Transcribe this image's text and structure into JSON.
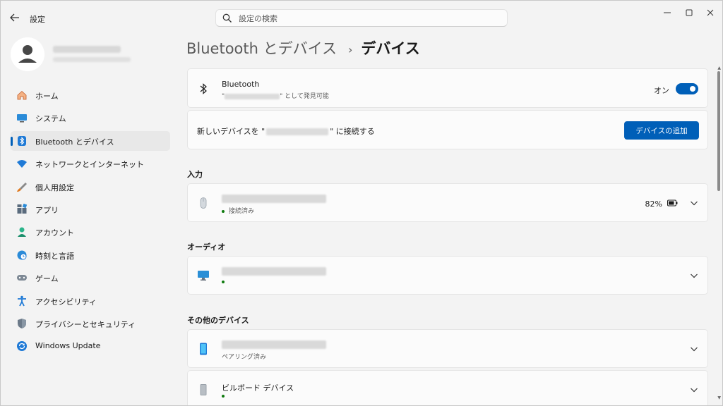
{
  "app": {
    "title": "設定"
  },
  "search": {
    "placeholder": "設定の検索"
  },
  "sidebar": {
    "items": [
      {
        "label": "ホーム"
      },
      {
        "label": "システム"
      },
      {
        "label": "Bluetooth とデバイス"
      },
      {
        "label": "ネットワークとインターネット"
      },
      {
        "label": "個人用設定"
      },
      {
        "label": "アプリ"
      },
      {
        "label": "アカウント"
      },
      {
        "label": "時刻と言語"
      },
      {
        "label": "ゲーム"
      },
      {
        "label": "アクセシビリティ"
      },
      {
        "label": "プライバシーとセキュリティ"
      },
      {
        "label": "Windows Update"
      }
    ],
    "active_index": 2
  },
  "breadcrumb": {
    "parent": "Bluetooth とデバイス",
    "separator": "›",
    "current": "デバイス"
  },
  "bluetooth_card": {
    "title": "Bluetooth",
    "sub_prefix": "\"",
    "sub_suffix": "\" として発見可能",
    "toggle_label": "オン",
    "toggle_on": true
  },
  "add_device_card": {
    "text_prefix": "新しいデバイスを \"",
    "text_suffix": "\" に接続する",
    "button_label": "デバイスの追加"
  },
  "sections": {
    "input": "入力",
    "audio": "オーディオ",
    "other": "その他のデバイス"
  },
  "devices": {
    "mouse": {
      "status": "接続済み",
      "battery": "82%"
    },
    "monitor": {
      "status": ""
    },
    "phone": {
      "status": "ペアリング済み"
    },
    "billboard": {
      "name": "ビルボード デバイス",
      "status": ""
    }
  },
  "colors": {
    "accent": "#005fb8",
    "connected_dot": "#0f7b0f",
    "window_bg": "#f3f3f3",
    "card_bg": "#fbfbfb"
  }
}
